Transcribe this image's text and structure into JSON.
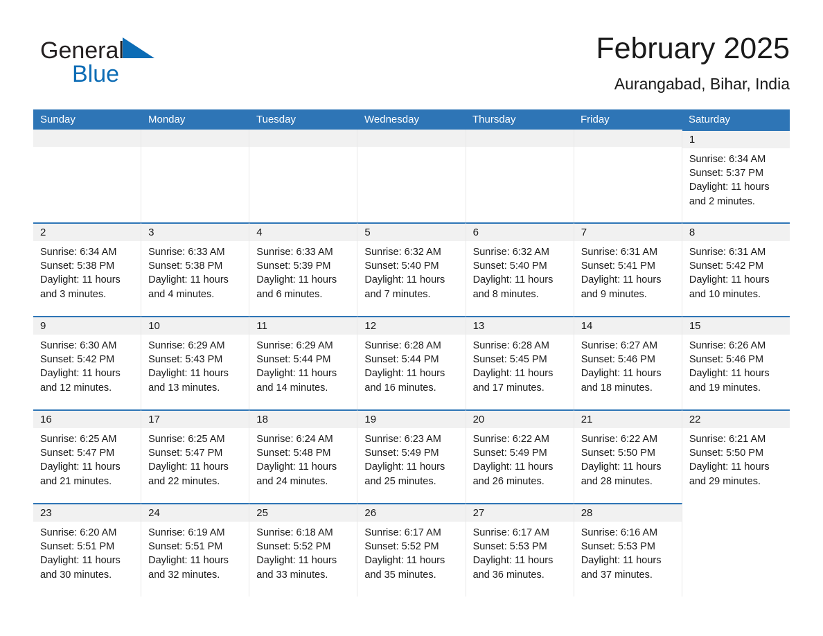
{
  "brand": {
    "name_part1": "General",
    "name_part2": "Blue",
    "triangle_color": "#0c6cb5",
    "text_color": "#231f20"
  },
  "header": {
    "title": "February 2025",
    "subtitle": "Aurangabad, Bihar, India"
  },
  "theme": {
    "header_band": "#2e75b6",
    "row_top_border": "#2e75b6",
    "daynum_band": "#f1f1f1",
    "text": "#1a1a1a"
  },
  "weekdays": [
    "Sunday",
    "Monday",
    "Tuesday",
    "Wednesday",
    "Thursday",
    "Friday",
    "Saturday"
  ],
  "weeks": [
    [
      {
        "day": "",
        "lines": [],
        "filled": false
      },
      {
        "day": "",
        "lines": [],
        "filled": false
      },
      {
        "day": "",
        "lines": [],
        "filled": false
      },
      {
        "day": "",
        "lines": [],
        "filled": false
      },
      {
        "day": "",
        "lines": [],
        "filled": false
      },
      {
        "day": "",
        "lines": [],
        "filled": false
      },
      {
        "day": "1",
        "filled": true,
        "sunrise": "Sunrise: 6:34 AM",
        "sunset": "Sunset: 5:37 PM",
        "daylight1": "Daylight: 11 hours",
        "daylight2": "and 2 minutes."
      }
    ],
    [
      {
        "day": "2",
        "filled": true,
        "sunrise": "Sunrise: 6:34 AM",
        "sunset": "Sunset: 5:38 PM",
        "daylight1": "Daylight: 11 hours",
        "daylight2": "and 3 minutes."
      },
      {
        "day": "3",
        "filled": true,
        "sunrise": "Sunrise: 6:33 AM",
        "sunset": "Sunset: 5:38 PM",
        "daylight1": "Daylight: 11 hours",
        "daylight2": "and 4 minutes."
      },
      {
        "day": "4",
        "filled": true,
        "sunrise": "Sunrise: 6:33 AM",
        "sunset": "Sunset: 5:39 PM",
        "daylight1": "Daylight: 11 hours",
        "daylight2": "and 6 minutes."
      },
      {
        "day": "5",
        "filled": true,
        "sunrise": "Sunrise: 6:32 AM",
        "sunset": "Sunset: 5:40 PM",
        "daylight1": "Daylight: 11 hours",
        "daylight2": "and 7 minutes."
      },
      {
        "day": "6",
        "filled": true,
        "sunrise": "Sunrise: 6:32 AM",
        "sunset": "Sunset: 5:40 PM",
        "daylight1": "Daylight: 11 hours",
        "daylight2": "and 8 minutes."
      },
      {
        "day": "7",
        "filled": true,
        "sunrise": "Sunrise: 6:31 AM",
        "sunset": "Sunset: 5:41 PM",
        "daylight1": "Daylight: 11 hours",
        "daylight2": "and 9 minutes."
      },
      {
        "day": "8",
        "filled": true,
        "sunrise": "Sunrise: 6:31 AM",
        "sunset": "Sunset: 5:42 PM",
        "daylight1": "Daylight: 11 hours",
        "daylight2": "and 10 minutes."
      }
    ],
    [
      {
        "day": "9",
        "filled": true,
        "sunrise": "Sunrise: 6:30 AM",
        "sunset": "Sunset: 5:42 PM",
        "daylight1": "Daylight: 11 hours",
        "daylight2": "and 12 minutes."
      },
      {
        "day": "10",
        "filled": true,
        "sunrise": "Sunrise: 6:29 AM",
        "sunset": "Sunset: 5:43 PM",
        "daylight1": "Daylight: 11 hours",
        "daylight2": "and 13 minutes."
      },
      {
        "day": "11",
        "filled": true,
        "sunrise": "Sunrise: 6:29 AM",
        "sunset": "Sunset: 5:44 PM",
        "daylight1": "Daylight: 11 hours",
        "daylight2": "and 14 minutes."
      },
      {
        "day": "12",
        "filled": true,
        "sunrise": "Sunrise: 6:28 AM",
        "sunset": "Sunset: 5:44 PM",
        "daylight1": "Daylight: 11 hours",
        "daylight2": "and 16 minutes."
      },
      {
        "day": "13",
        "filled": true,
        "sunrise": "Sunrise: 6:28 AM",
        "sunset": "Sunset: 5:45 PM",
        "daylight1": "Daylight: 11 hours",
        "daylight2": "and 17 minutes."
      },
      {
        "day": "14",
        "filled": true,
        "sunrise": "Sunrise: 6:27 AM",
        "sunset": "Sunset: 5:46 PM",
        "daylight1": "Daylight: 11 hours",
        "daylight2": "and 18 minutes."
      },
      {
        "day": "15",
        "filled": true,
        "sunrise": "Sunrise: 6:26 AM",
        "sunset": "Sunset: 5:46 PM",
        "daylight1": "Daylight: 11 hours",
        "daylight2": "and 19 minutes."
      }
    ],
    [
      {
        "day": "16",
        "filled": true,
        "sunrise": "Sunrise: 6:25 AM",
        "sunset": "Sunset: 5:47 PM",
        "daylight1": "Daylight: 11 hours",
        "daylight2": "and 21 minutes."
      },
      {
        "day": "17",
        "filled": true,
        "sunrise": "Sunrise: 6:25 AM",
        "sunset": "Sunset: 5:47 PM",
        "daylight1": "Daylight: 11 hours",
        "daylight2": "and 22 minutes."
      },
      {
        "day": "18",
        "filled": true,
        "sunrise": "Sunrise: 6:24 AM",
        "sunset": "Sunset: 5:48 PM",
        "daylight1": "Daylight: 11 hours",
        "daylight2": "and 24 minutes."
      },
      {
        "day": "19",
        "filled": true,
        "sunrise": "Sunrise: 6:23 AM",
        "sunset": "Sunset: 5:49 PM",
        "daylight1": "Daylight: 11 hours",
        "daylight2": "and 25 minutes."
      },
      {
        "day": "20",
        "filled": true,
        "sunrise": "Sunrise: 6:22 AM",
        "sunset": "Sunset: 5:49 PM",
        "daylight1": "Daylight: 11 hours",
        "daylight2": "and 26 minutes."
      },
      {
        "day": "21",
        "filled": true,
        "sunrise": "Sunrise: 6:22 AM",
        "sunset": "Sunset: 5:50 PM",
        "daylight1": "Daylight: 11 hours",
        "daylight2": "and 28 minutes."
      },
      {
        "day": "22",
        "filled": true,
        "sunrise": "Sunrise: 6:21 AM",
        "sunset": "Sunset: 5:50 PM",
        "daylight1": "Daylight: 11 hours",
        "daylight2": "and 29 minutes."
      }
    ],
    [
      {
        "day": "23",
        "filled": true,
        "sunrise": "Sunrise: 6:20 AM",
        "sunset": "Sunset: 5:51 PM",
        "daylight1": "Daylight: 11 hours",
        "daylight2": "and 30 minutes."
      },
      {
        "day": "24",
        "filled": true,
        "sunrise": "Sunrise: 6:19 AM",
        "sunset": "Sunset: 5:51 PM",
        "daylight1": "Daylight: 11 hours",
        "daylight2": "and 32 minutes."
      },
      {
        "day": "25",
        "filled": true,
        "sunrise": "Sunrise: 6:18 AM",
        "sunset": "Sunset: 5:52 PM",
        "daylight1": "Daylight: 11 hours",
        "daylight2": "and 33 minutes."
      },
      {
        "day": "26",
        "filled": true,
        "sunrise": "Sunrise: 6:17 AM",
        "sunset": "Sunset: 5:52 PM",
        "daylight1": "Daylight: 11 hours",
        "daylight2": "and 35 minutes."
      },
      {
        "day": "27",
        "filled": true,
        "sunrise": "Sunrise: 6:17 AM",
        "sunset": "Sunset: 5:53 PM",
        "daylight1": "Daylight: 11 hours",
        "daylight2": "and 36 minutes."
      },
      {
        "day": "28",
        "filled": true,
        "sunrise": "Sunrise: 6:16 AM",
        "sunset": "Sunset: 5:53 PM",
        "daylight1": "Daylight: 11 hours",
        "daylight2": "and 37 minutes."
      },
      {
        "day": "",
        "lines": [],
        "filled": false
      }
    ]
  ]
}
